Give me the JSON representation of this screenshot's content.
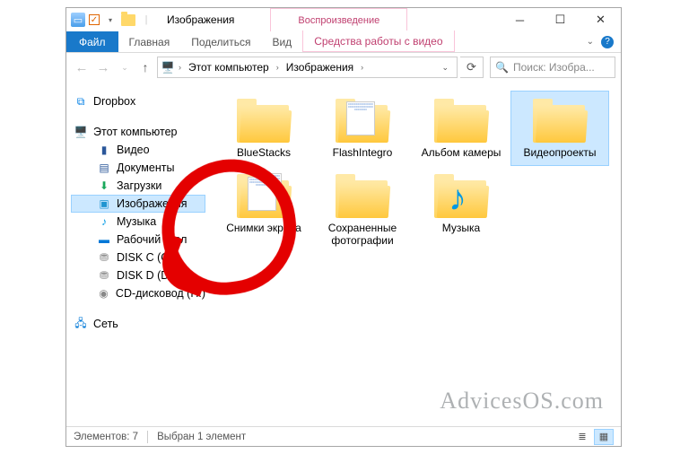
{
  "window": {
    "title": "Изображения",
    "context_tab_title": "Воспроизведение",
    "context_ribbon_label": "Средства работы с видео"
  },
  "ribbon": {
    "file": "Файл",
    "home": "Главная",
    "share": "Поделиться",
    "view": "Вид"
  },
  "address": {
    "root": "Этот компьютер",
    "current": "Изображения"
  },
  "search": {
    "placeholder": "Поиск: Изобра..."
  },
  "nav": {
    "dropbox": "Dropbox",
    "this_pc": "Этот компьютер",
    "videos": "Видео",
    "documents": "Документы",
    "downloads": "Загрузки",
    "pictures": "Изображения",
    "music": "Музыка",
    "desktop": "Рабочий стол",
    "disk_c": "DISK C (C:)",
    "disk_d": "DISK D (D:)",
    "cd": "CD-дисковод (H:)",
    "network": "Сеть"
  },
  "items": [
    {
      "label": "BlueStacks",
      "preview": false
    },
    {
      "label": "FlashIntegro",
      "preview": true
    },
    {
      "label": "Альбом камеры",
      "preview": false
    },
    {
      "label": "Видеопроекты",
      "preview": false,
      "selected": true
    },
    {
      "label": "Снимки экрана",
      "preview": true,
      "double": true
    },
    {
      "label": "Сохраненные фотографии",
      "preview": false
    },
    {
      "label": "Музыка",
      "preview": false,
      "music": true
    }
  ],
  "status": {
    "count": "Элементов: 7",
    "selected": "Выбран 1 элемент"
  },
  "watermark": "AdvicesOS.com"
}
